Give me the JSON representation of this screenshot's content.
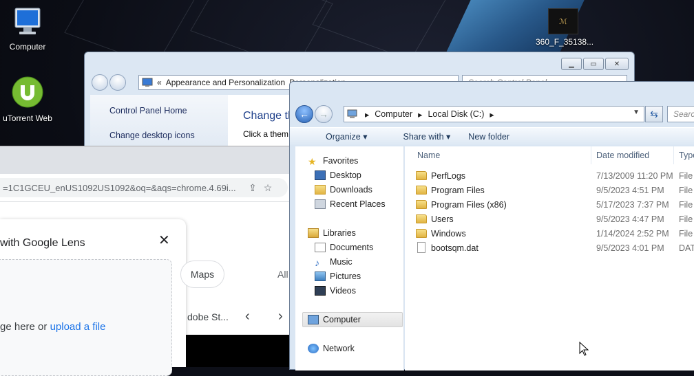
{
  "desktop": {
    "icons": [
      {
        "label": "Computer",
        "icon": "computer-icon"
      },
      {
        "label": "uTorrent Web",
        "icon": "utorrent-icon"
      },
      {
        "label": "360_F_35138...",
        "icon": "image-thumbnail-icon"
      }
    ]
  },
  "control_panel": {
    "breadcrumb_prefix": "«",
    "breadcrumb": "Appearance and Personalization",
    "breadcrumb_next": "Personalization",
    "search_placeholder": "Search Control Panel",
    "left_links": [
      "Control Panel Home",
      "Change desktop icons"
    ],
    "heading": "Change th",
    "subtext": "Click a them"
  },
  "chrome": {
    "address_text": "=1C1GCEU_enUS1092US1092&oq=&aqs=chrome.4.69i...",
    "lens_title": "with Google Lens",
    "lens_prompt_prefix": "ge here or",
    "lens_prompt_link": "upload a file",
    "chip_maps": "Maps",
    "chip_all": "All",
    "carousel_text": "dobe St..."
  },
  "explorer": {
    "address_segments": [
      "Computer",
      "Local Disk (C:)"
    ],
    "search_placeholder": "Searc",
    "toolbar": {
      "organize": "Organize",
      "share_with": "Share with",
      "new_folder": "New folder"
    },
    "nav": {
      "favorites": "Favorites",
      "favorites_items": [
        "Desktop",
        "Downloads",
        "Recent Places"
      ],
      "libraries": "Libraries",
      "libraries_items": [
        "Documents",
        "Music",
        "Pictures",
        "Videos"
      ],
      "computer": "Computer",
      "network": "Network"
    },
    "columns": {
      "name": "Name",
      "date": "Date modified",
      "type": "Type"
    },
    "rows": [
      {
        "name": "PerfLogs",
        "date": "7/13/2009 11:20 PM",
        "type": "File",
        "kind": "folder"
      },
      {
        "name": "Program Files",
        "date": "9/5/2023 4:51 PM",
        "type": "File",
        "kind": "folder"
      },
      {
        "name": "Program Files (x86)",
        "date": "5/17/2023 7:37 PM",
        "type": "File",
        "kind": "folder"
      },
      {
        "name": "Users",
        "date": "9/5/2023 4:47 PM",
        "type": "File",
        "kind": "folder"
      },
      {
        "name": "Windows",
        "date": "1/14/2024 2:52 PM",
        "type": "File",
        "kind": "folder"
      },
      {
        "name": "bootsqm.dat",
        "date": "9/5/2023 4:01 PM",
        "type": "DAT",
        "kind": "file"
      }
    ]
  }
}
